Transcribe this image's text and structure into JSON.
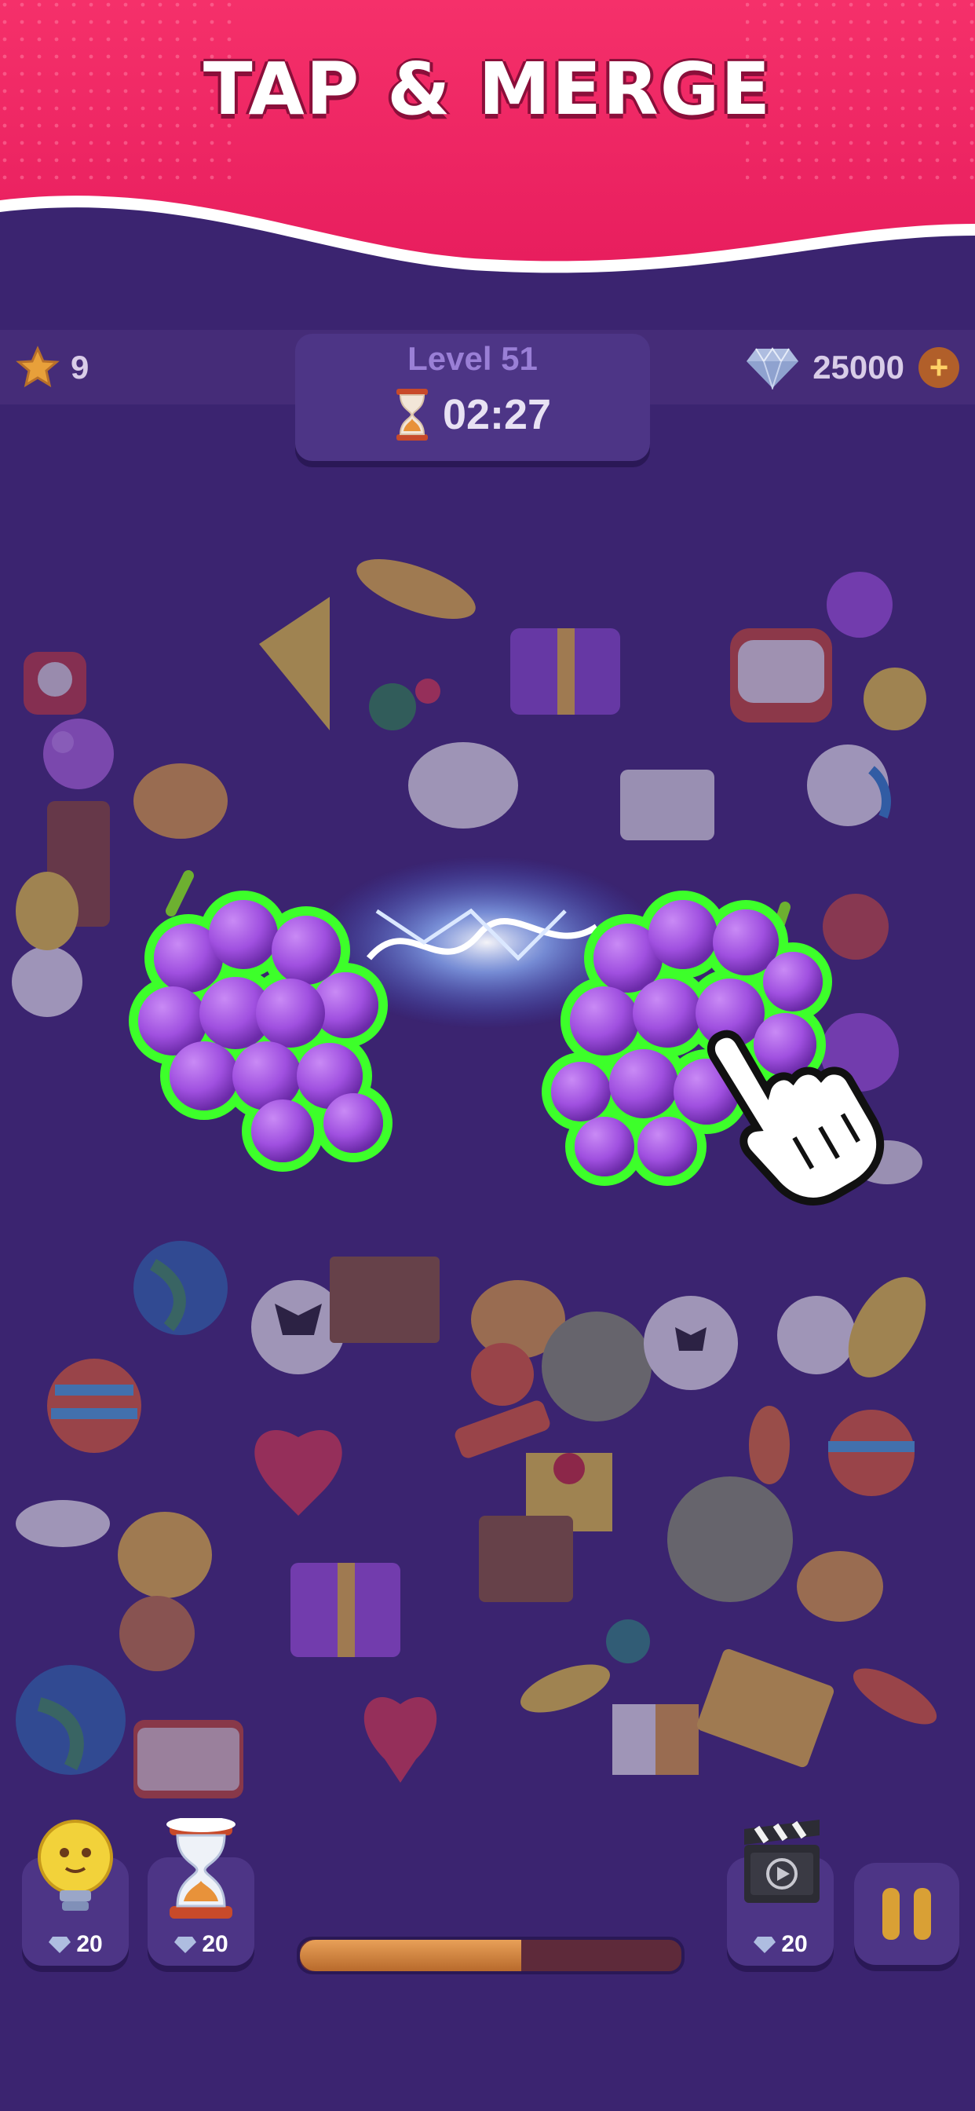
{
  "banner": {
    "title": "TAP & MERGE"
  },
  "hud": {
    "stars": "9",
    "level": "Level 51",
    "timer": "02:27",
    "gems": "25000"
  },
  "icons": {
    "star": "star-icon",
    "gem": "diamond-icon",
    "add": "plus-icon",
    "hourglass": "hourglass-icon",
    "hint": "lightbulb-icon",
    "freeze": "frozen-hourglass-icon",
    "video": "clapperboard-icon",
    "pause": "pause-icon",
    "hand": "tap-hand-icon"
  },
  "boosters": {
    "hint": {
      "cost": "20"
    },
    "freeze": {
      "cost": "20"
    },
    "video": {
      "cost": "20"
    }
  },
  "progress": {
    "fraction": 0.58
  },
  "colors": {
    "banner": "#f0336a",
    "background": "#3b2470",
    "selected_outline": "#3dff2a",
    "grape": "#a050e0",
    "progress": "#d98a45"
  }
}
